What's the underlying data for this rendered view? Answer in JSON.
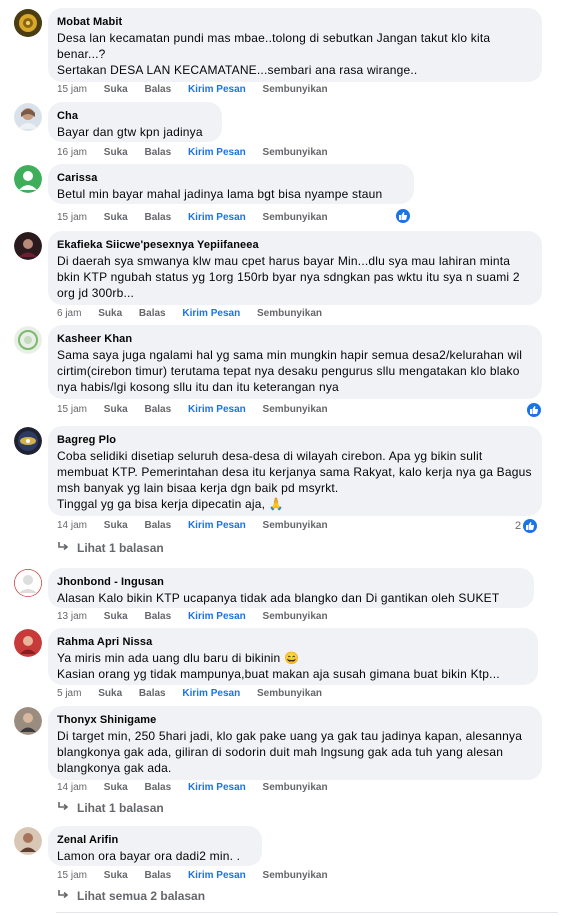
{
  "actions": {
    "like": "Suka",
    "reply": "Balas",
    "send": "Kirim Pesan",
    "hide": "Sembunyikan"
  },
  "comments": [
    {
      "author": "Mobat Mabit",
      "text": "Desa lan kecamatan pundi mas mbae..tolong di sebutkan Jangan takut klo kita benar...?\nSertakan DESA LAN KECAMATANE...sembari ana rasa wirange..",
      "time": "15 jam"
    },
    {
      "author": "Cha",
      "text": "Bayar dan gtw kpn jadinya",
      "time": "16 jam"
    },
    {
      "author": "Carissa",
      "text": "Betul min bayar mahal jadinya lama bgt bisa nyampe staun",
      "time": "15 jam"
    },
    {
      "author": "Ekafieka Siicwe'pesexnya Yepiifaneea",
      "text": "Di daerah sya smwanya klw mau cpet harus bayar Min...dlu sya mau lahiran minta bkin KTP ngubah status yg 1org 150rb byar nya sdngkan pas wktu itu sya n suami 2 org jd 300rb...",
      "time": "6 jam"
    },
    {
      "author": "Kasheer Khan",
      "text": "Sama saya juga ngalami hal yg sama min mungkin hapir semua desa2/kelurahan wil cirtim(cirebon timur) terutama tepat nya desaku pengurus sllu mengatakan klo blako nya habis/lgi kosong sllu itu dan itu keterangan nya",
      "time": "15 jam"
    },
    {
      "author": "Bagreg Plo",
      "text": "Coba selidiki disetiap seluruh desa-desa di wilayah cirebon. Apa yg bikin sulit membuat KTP. Pemerintahan desa itu kerjanya sama Rakyat, kalo kerja nya ga Bagus msh banyak yg lain bisaa kerja dgn baik pd msyrkt.\nTinggal yg ga bisa kerja dipecatin aja, 🙏",
      "time": "14 jam",
      "likes": "2",
      "replies": "Lihat 1 balasan"
    },
    {
      "author": "Jhonbond - Ingusan",
      "text": "Alasan Kalo bikin KTP ucapanya tidak ada blangko dan Di gantikan oleh SUKET",
      "time": "13 jam"
    },
    {
      "author": "Rahma Apri Nissa",
      "text": "Ya miris min ada uang dlu baru di bikinin 😄\nKasian orang yg tidak mampunya,buat makan aja susah gimana buat bikin Ktp...",
      "time": "5 jam"
    },
    {
      "author": "Thonyx Shinigame",
      "text": "Di target min, 250 5hari jadi, klo gak pake uang ya gak tau jadinya kapan, alesannya blangkonya gak ada, giliran di sodorin duit mah lngsung gak ada tuh yang alesan blangkonya gak ada.",
      "time": "14 jam",
      "replies": "Lihat 1 balasan"
    },
    {
      "author": "Zenal Arifin",
      "text": "Lamon ora bayar ora dadi2 min. .",
      "time": "15 jam",
      "replies": "Lihat semua 2 balasan"
    }
  ]
}
